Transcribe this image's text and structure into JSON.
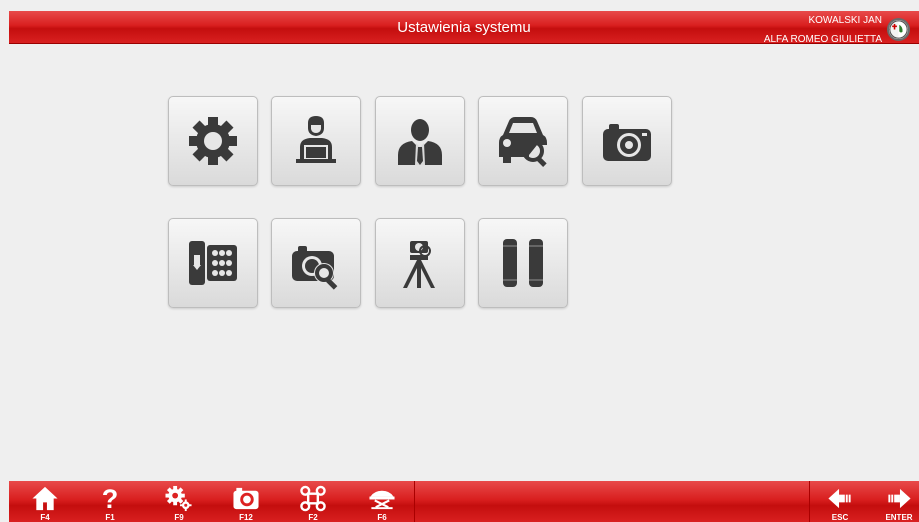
{
  "header": {
    "title": "Ustawienia systemu",
    "user": "KOWALSKI JAN",
    "vehicle": "ALFA ROMEO GIULIETTA",
    "logo_icon": "alfa-romeo-logo"
  },
  "grid": {
    "row1": [
      {
        "name": "settings",
        "icon": "gear-icon"
      },
      {
        "name": "operator",
        "icon": "operator-laptop-icon"
      },
      {
        "name": "customer",
        "icon": "person-suit-icon"
      },
      {
        "name": "vehicle-search",
        "icon": "car-search-icon"
      },
      {
        "name": "camera",
        "icon": "camera-icon"
      }
    ],
    "row2": [
      {
        "name": "wheel-database",
        "icon": "wheel-keypad-icon"
      },
      {
        "name": "camera-diagnostics",
        "icon": "camera-search-icon"
      },
      {
        "name": "camera-tripod",
        "icon": "tripod-camera-icon"
      },
      {
        "name": "wheel-targets",
        "icon": "wheel-targets-icon"
      }
    ]
  },
  "footer": {
    "buttons": [
      {
        "icon": "home-icon",
        "key": "F4"
      },
      {
        "icon": "help-icon",
        "key": "F1"
      },
      {
        "icon": "gears-icon",
        "key": "F9"
      },
      {
        "icon": "camera-icon",
        "key": "F12"
      },
      {
        "icon": "command-icon",
        "key": "F2"
      },
      {
        "icon": "lift-icon",
        "key": "F6"
      }
    ],
    "esc": {
      "icon": "back-arrow-icon",
      "key": "ESC"
    },
    "enter": {
      "icon": "forward-arrow-icon",
      "key": "ENTER"
    }
  },
  "colors": {
    "header": "#d91f1f",
    "background": "#efefef",
    "icon": "#3a3a3a"
  }
}
